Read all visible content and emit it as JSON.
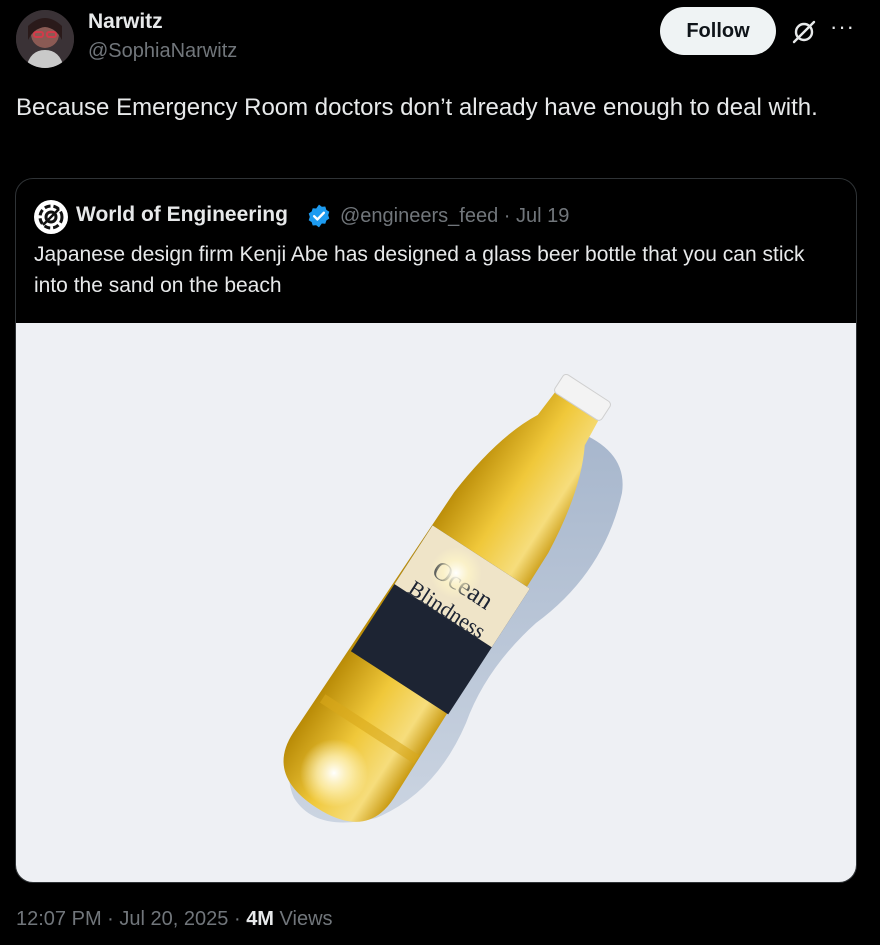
{
  "author": {
    "name": "Narwitz",
    "handle": "@SophiaNarwitz"
  },
  "actions": {
    "follow_label": "Follow",
    "grok_icon": "grok-icon",
    "more_icon": "more-icon"
  },
  "post": {
    "text": "Because Emergency Room doctors don’t already have enough to deal with."
  },
  "quoted": {
    "name": "World of Engineering",
    "handle": "@engineers_feed",
    "separator": "·",
    "date": "Jul 19",
    "text": "Japanese design firm Kenji Abe has designed a glass beer bottle that you can stick into the sand on the beach",
    "media": {
      "label_line1": "Ocean",
      "label_line2": "Blindness"
    }
  },
  "footer": {
    "time": "12:07 PM",
    "sep1": "·",
    "date": "Jul 20, 2025",
    "sep2": "·",
    "views_count": "4M",
    "views_label": "Views"
  },
  "colors": {
    "background": "#000000",
    "text": "#e7e9ea",
    "muted": "#71767b",
    "verified": "#1d9bf0",
    "beer": "#e8b720"
  }
}
